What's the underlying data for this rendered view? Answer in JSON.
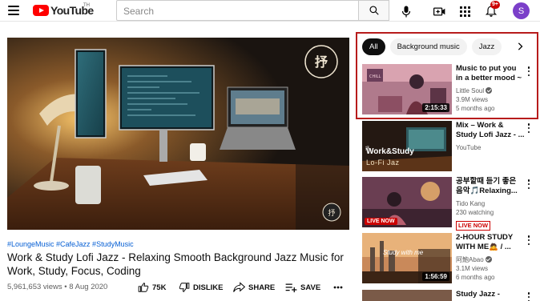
{
  "header": {
    "logo_text": "YouTube",
    "logo_region": "TH",
    "search_placeholder": "Search",
    "notification_count": "9+",
    "avatar_initial": "S",
    "icons": [
      "menu-icon",
      "search-icon",
      "mic-icon",
      "create-icon",
      "apps-icon",
      "bell-icon"
    ]
  },
  "video": {
    "tags": "#LoungeMusic #CafeJazz #StudyMusic",
    "title": "Work & Study Lofi Jazz - Relaxing Smooth Background Jazz Music for Work, Study, Focus, Coding",
    "views_date": "5,961,653 views • 8 Aug 2020",
    "likes": "75K",
    "dislike_label": "DISLIKE",
    "share_label": "SHARE",
    "save_label": "SAVE"
  },
  "chips": [
    "All",
    "Background music",
    "Jazz"
  ],
  "recommendations": [
    {
      "title": "Music to put you in a better mood ~ ...",
      "channel": "Little Soul",
      "verified": true,
      "views": "3.9M views",
      "age": "5 months ago",
      "duration": "2:15:33",
      "live": false
    },
    {
      "title": "Mix – Work & Study Lofi Jazz - ...",
      "channel": "YouTube",
      "verified": false,
      "views": "",
      "age": "",
      "duration": "",
      "thumb_text": "Work&Study",
      "thumb_sub": "Lo-Fi Jaz",
      "live": false
    },
    {
      "title": "공부할때 듣기 좋은 음악🎵Relaxing...",
      "channel": "Tido Kang",
      "verified": false,
      "views": "230 watching",
      "age": "",
      "duration": "",
      "live": true,
      "live_label": "LIVE NOW",
      "thumb_badge": "LIVE NOW"
    },
    {
      "title": "2-HOUR STUDY WITH ME🙇 / ...",
      "channel": "阿鮑Abao",
      "verified": true,
      "views": "3.1M views",
      "age": "6 months ago",
      "duration": "1:56:59",
      "thumb_text": "Study with me",
      "live": false
    },
    {
      "title": "Study Jazz -",
      "channel": "",
      "verified": false,
      "views": "",
      "age": "",
      "duration": "",
      "live": false
    }
  ],
  "colors": {
    "brand_red": "#ff0000",
    "link_blue": "#065fd4",
    "highlight_border": "#b71c1c",
    "live_red": "#cc0000",
    "avatar_purple": "#7b3fc9"
  }
}
